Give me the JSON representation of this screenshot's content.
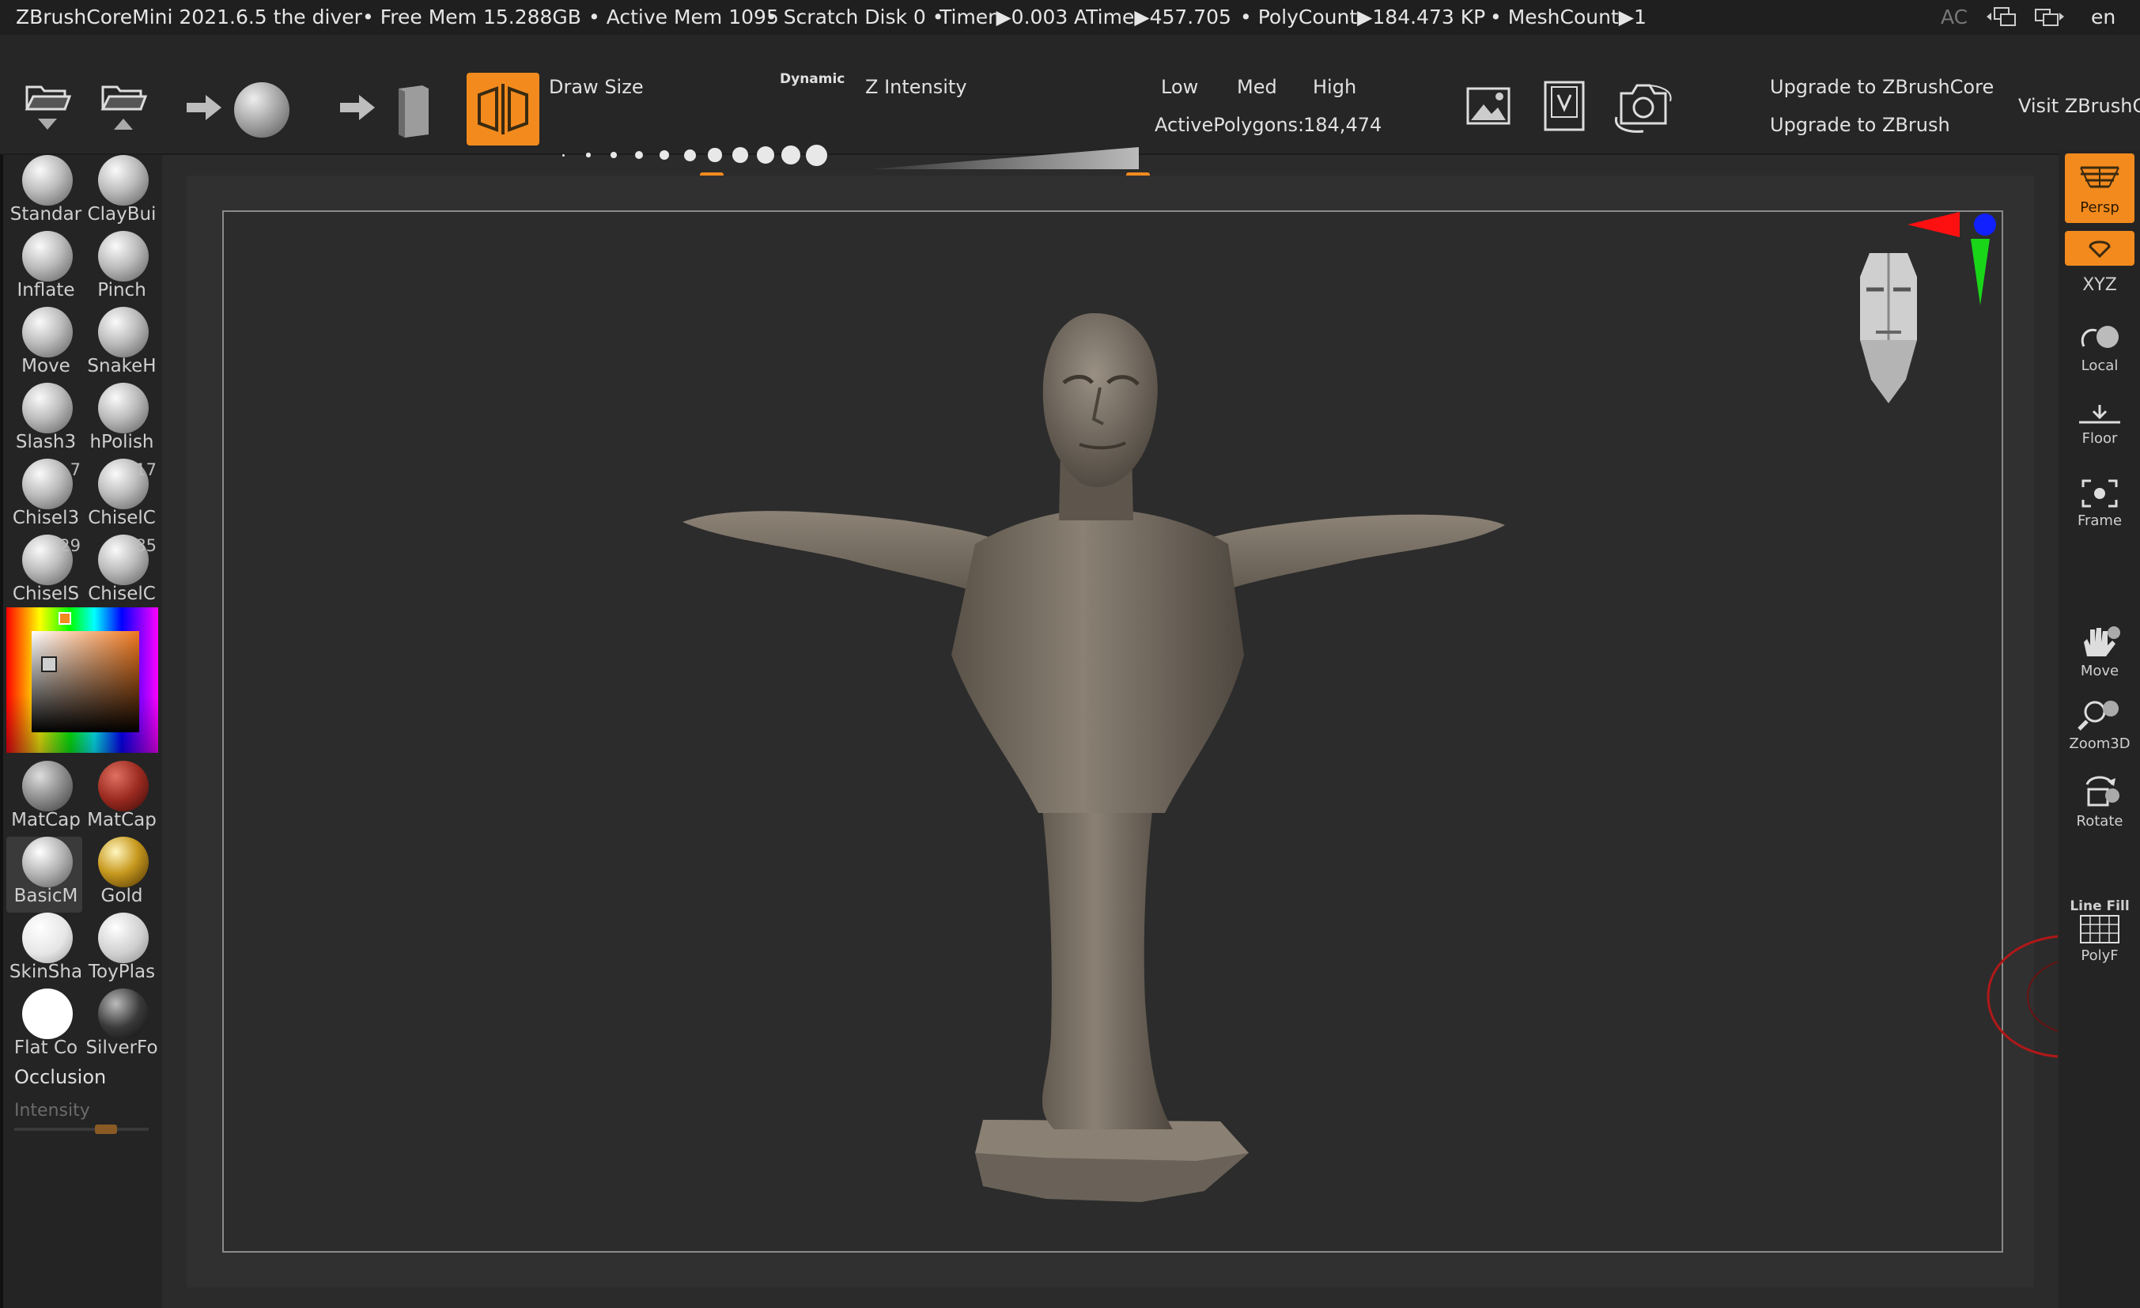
{
  "status_bar": {
    "app_title": "ZBrushCoreMini 2021.6.5 the diver",
    "free_mem": "• Free Mem 15.288GB",
    "active_mem": "• Active Mem 1095",
    "scratch_disk": "• Scratch Disk 0 •",
    "timer": "Timer▶0.003",
    "atime": "ATime▶457.705",
    "polycount": "• PolyCount▶184.473 KP",
    "meshcount": "• MeshCount▶1",
    "ac": "AC",
    "language": "en"
  },
  "toolbar": {
    "draw_size_label": "Draw Size",
    "dynamic_label": "Dynamic",
    "z_intensity_label": "Z Intensity",
    "low_label": "Low",
    "med_label": "Med",
    "high_label": "High",
    "active_polygons_label": "ActivePolygons:",
    "active_polygons_value": "184,474",
    "upgrade_core": "Upgrade to ZBrushCore",
    "upgrade_zbrush": "Upgrade to ZBrush",
    "visit": "Visit ZBrushC",
    "draw_size_level": 0.56,
    "z_intensity_level": 1.0
  },
  "left_shelf": {
    "brushes": [
      {
        "label": "Standar",
        "count": ""
      },
      {
        "label": "ClayBui",
        "count": ""
      },
      {
        "label": "Inflate",
        "count": ""
      },
      {
        "label": "Pinch",
        "count": ""
      },
      {
        "label": "Move",
        "count": ""
      },
      {
        "label": "SnakeH",
        "count": ""
      },
      {
        "label": "Slash3",
        "count": ""
      },
      {
        "label": "hPolish",
        "count": ""
      },
      {
        "label": "Chisel3",
        "count": "7"
      },
      {
        "label": "ChiselC",
        "count": "17"
      },
      {
        "label": "ChiselS",
        "count": "29"
      },
      {
        "label": "ChiselC",
        "count": "85"
      }
    ],
    "materials": [
      {
        "label": "MatCap"
      },
      {
        "label": "MatCap"
      },
      {
        "label": "BasicM"
      },
      {
        "label": "Gold"
      },
      {
        "label": "SkinSha"
      },
      {
        "label": "ToyPlas"
      },
      {
        "label": "Flat Co"
      },
      {
        "label": "SilverFo"
      }
    ],
    "occlusion_label": "Occlusion",
    "intensity_label": "Intensity"
  },
  "right_shelf": {
    "persp": "Persp",
    "xyz": "XYZ",
    "local": "Local",
    "floor": "Floor",
    "frame": "Frame",
    "move": "Move",
    "zoom3d": "Zoom3D",
    "rotate": "Rotate",
    "line_fill": "Line Fill",
    "polyf": "PolyF"
  },
  "colors": {
    "accent": "#f28a1e",
    "background": "#2b2b2b",
    "model": "#7e7569"
  }
}
